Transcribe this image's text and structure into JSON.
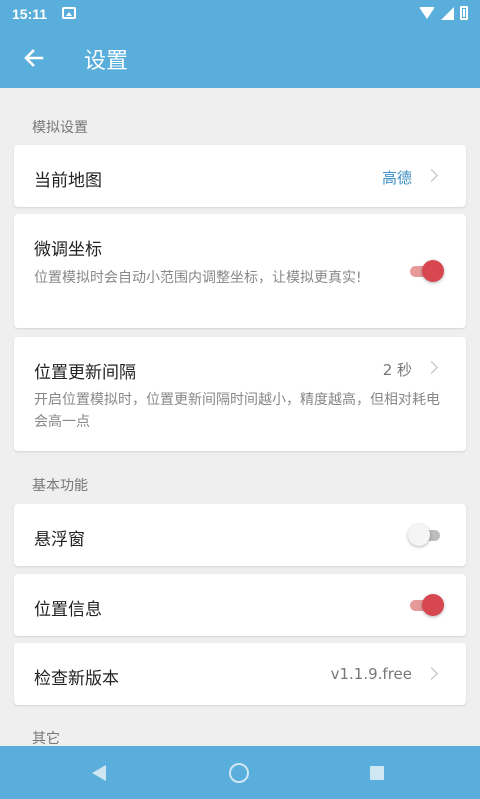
{
  "status_bar": {
    "time": "15:11"
  },
  "app_bar": {
    "title": "设置"
  },
  "sections": {
    "simulation": {
      "title": "模拟设置"
    },
    "basic": {
      "title": "基本功能"
    },
    "other": {
      "title": "其它"
    }
  },
  "settings": {
    "current_map": {
      "label": "当前地图",
      "value": "高德"
    },
    "fine_tune": {
      "label": "微调坐标",
      "description": "位置模拟时会自动小范围内调整坐标，让模拟更真实!",
      "enabled": true
    },
    "update_interval": {
      "label": "位置更新间隔",
      "value": "2 秒",
      "description": "开启位置模拟时，位置更新间隔时间越小，精度越高，但相对耗电会高一点"
    },
    "floating_window": {
      "label": "悬浮窗",
      "enabled": false
    },
    "location_info": {
      "label": "位置信息",
      "enabled": true
    },
    "check_update": {
      "label": "检查新版本",
      "value": "v1.1.9.free"
    }
  },
  "colors": {
    "primary": "#5aaedb",
    "accent": "#d6474f",
    "link_value": "#3d8fc4"
  }
}
